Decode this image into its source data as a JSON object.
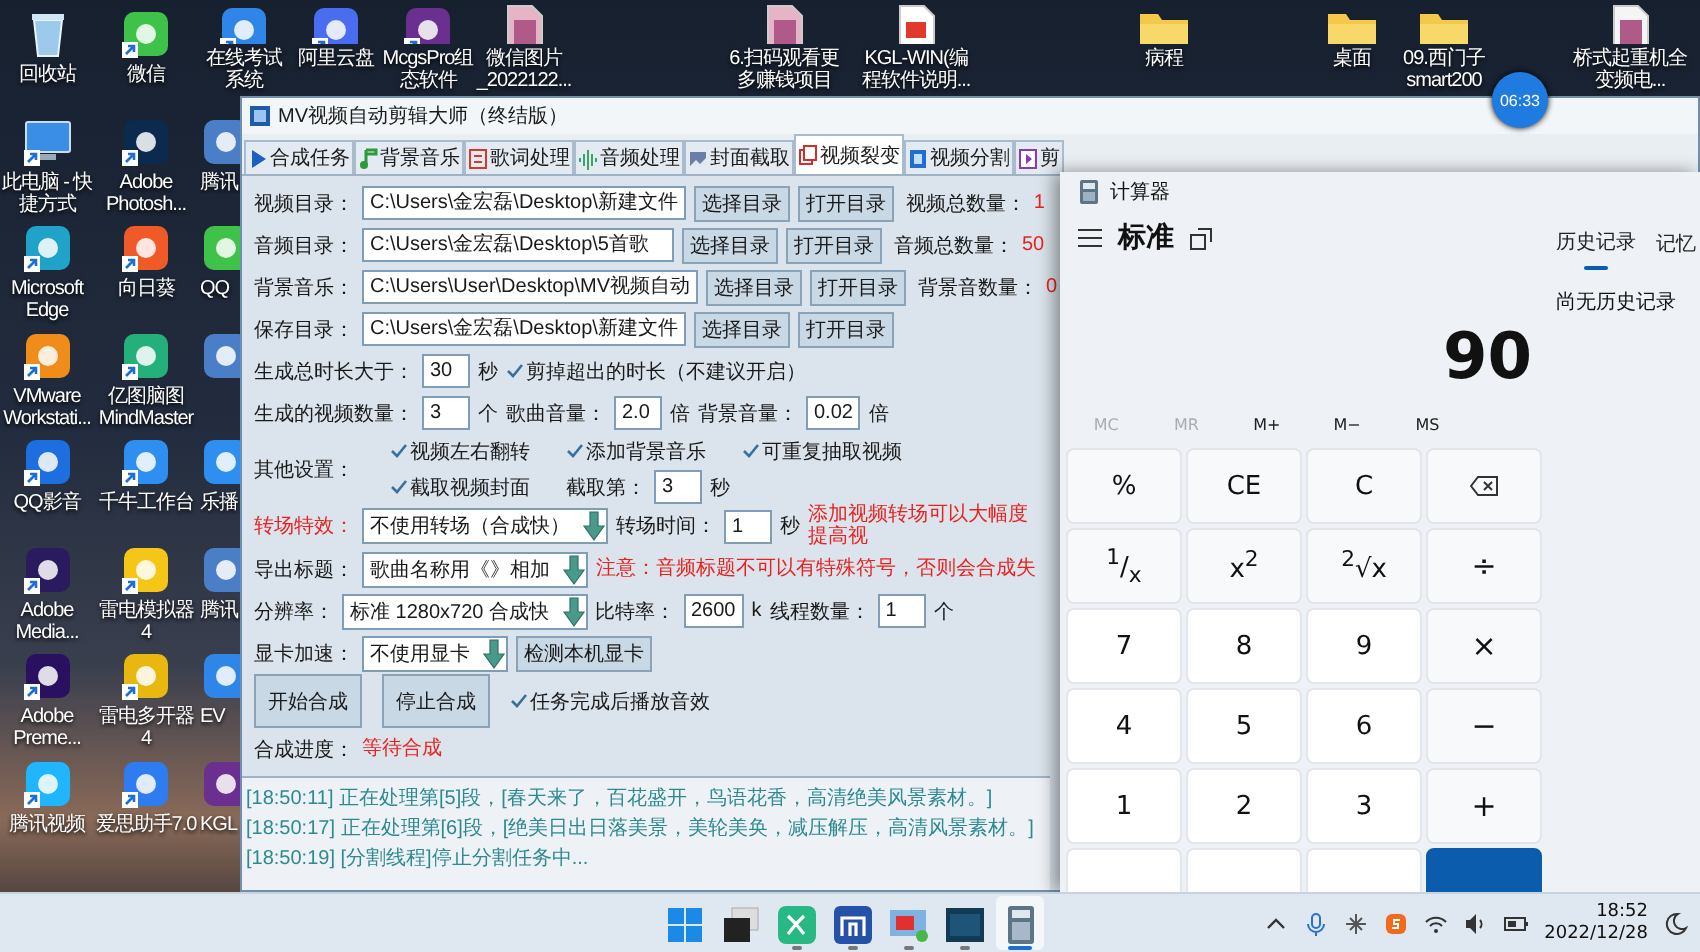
{
  "desktop": {
    "left_icons": [
      {
        "label": "回收站",
        "kind": "recycle",
        "shortcut": false
      },
      {
        "label": "此电脑 - 快捷方式",
        "kind": "monitor",
        "shortcut": true
      },
      {
        "label": "Microsoft Edge",
        "kind": "edge",
        "shortcut": true
      },
      {
        "label": "VMware Workstati...",
        "kind": "vmware",
        "shortcut": true
      },
      {
        "label": "QQ影音",
        "kind": "player",
        "shortcut": true
      },
      {
        "label": "Adobe Media...",
        "kind": "media-encoder",
        "shortcut": true
      },
      {
        "label": "Adobe Preme...",
        "kind": "premiere",
        "shortcut": true
      },
      {
        "label": "腾讯视频",
        "kind": "video",
        "shortcut": true
      },
      {
        "label": "微信",
        "kind": "chat",
        "shortcut": true
      },
      {
        "label": "Adobe Photosh...",
        "kind": "photoshop",
        "shortcut": true
      },
      {
        "label": "向日葵",
        "kind": "remote",
        "shortcut": true
      },
      {
        "label": "亿图脑图 MindMaster",
        "kind": "mindmap",
        "shortcut": true
      },
      {
        "label": "千牛工作台",
        "kind": "workbench",
        "shortcut": true
      },
      {
        "label": "雷电模拟器4",
        "kind": "emulator",
        "shortcut": true
      },
      {
        "label": "雷电多开器4",
        "kind": "multi",
        "shortcut": true
      },
      {
        "label": "爱思助手7.0",
        "kind": "assistant",
        "shortcut": true
      }
    ],
    "partial_icons": [
      {
        "label": "腾讯",
        "kind": "app"
      },
      {
        "label": "QQ",
        "kind": "chat"
      },
      {
        "kind": "app"
      },
      {
        "label": "乐播",
        "kind": "workbench"
      },
      {
        "label": "腾讯",
        "kind": "app"
      },
      {
        "label": "EV",
        "kind": "exam"
      },
      {
        "label": "KGL",
        "kind": "mcgs"
      }
    ],
    "top_icons": [
      {
        "label": "在线考试系统",
        "kind": "exam",
        "shortcut": true
      },
      {
        "label": "阿里云盘",
        "kind": "cloud",
        "shortcut": true
      },
      {
        "label": "McgsPro组态软件",
        "kind": "mcgs",
        "shortcut": true
      },
      {
        "label": "微信图片_2022122...",
        "kind": "image",
        "shortcut": false
      },
      {
        "label": "6.扫码观看更多赚钱项目",
        "kind": "image",
        "shortcut": false
      },
      {
        "label": "KGL-WIN(编程软件说明...",
        "kind": "pdf",
        "shortcut": false
      },
      {
        "label": "病程",
        "kind": "folder",
        "shortcut": false
      },
      {
        "label": "桌面",
        "kind": "folder",
        "shortcut": false
      },
      {
        "label": "09.西门子smart200",
        "kind": "folder",
        "shortcut": false
      },
      {
        "label": "桥式起重机全变频电...",
        "kind": "document",
        "shortcut": false
      }
    ],
    "timer": "06:33"
  },
  "app": {
    "title": "MV视频自动剪辑大师（终结版）",
    "tabs": [
      {
        "label": "合成任务",
        "kind": "play",
        "selected": false
      },
      {
        "label": "背景音乐",
        "kind": "music",
        "selected": false
      },
      {
        "label": "歌词处理",
        "kind": "lyrics",
        "selected": false
      },
      {
        "label": "音频处理",
        "kind": "audio",
        "selected": false
      },
      {
        "label": "封面截取",
        "kind": "image",
        "selected": false
      },
      {
        "label": "视频裂变",
        "kind": "copy",
        "selected": true
      },
      {
        "label": "视频分割",
        "kind": "film",
        "selected": false
      },
      {
        "label": "剪",
        "kind": "clip",
        "selected": false
      }
    ],
    "rows": [
      {
        "items": [
          {
            "kind": "label",
            "text": "视频目录："
          },
          {
            "kind": "path",
            "value": "C:\\Users\\金宏磊\\Desktop\\新建文件"
          },
          {
            "kind": "button",
            "text": "选择目录"
          },
          {
            "kind": "button",
            "text": "打开目录"
          },
          {
            "kind": "stat",
            "text": "视频总数量："
          },
          {
            "kind": "value",
            "text": "1"
          },
          {
            "kind": "cursor"
          }
        ]
      },
      {
        "items": [
          {
            "kind": "label",
            "text": "音频目录："
          },
          {
            "kind": "path",
            "value": "C:\\Users\\金宏磊\\Desktop\\5首歌"
          },
          {
            "kind": "button",
            "text": "选择目录"
          },
          {
            "kind": "button",
            "text": "打开目录"
          },
          {
            "kind": "stat",
            "text": "音频总数量："
          },
          {
            "kind": "value",
            "text": "50"
          }
        ]
      },
      {
        "items": [
          {
            "kind": "label",
            "text": "背景音乐："
          },
          {
            "kind": "path",
            "value": "C:\\Users\\User\\Desktop\\MV视频自动"
          },
          {
            "kind": "button",
            "text": "选择目录"
          },
          {
            "kind": "button",
            "text": "打开目录"
          },
          {
            "kind": "stat",
            "text": "背景音数量："
          },
          {
            "kind": "value",
            "text": "0"
          }
        ]
      },
      {
        "items": [
          {
            "kind": "label",
            "text": "保存目录："
          },
          {
            "kind": "path",
            "value": "C:\\Users\\金宏磊\\Desktop\\新建文件"
          },
          {
            "kind": "button",
            "text": "选择目录"
          },
          {
            "kind": "button",
            "text": "打开目录"
          }
        ]
      },
      {
        "items": [
          {
            "kind": "label",
            "text": "生成总时长大于："
          },
          {
            "kind": "number",
            "value": "30"
          },
          {
            "kind": "unit",
            "text": "秒"
          },
          {
            "kind": "check",
            "text": "剪掉超出的时长（不建议开启）",
            "checked": true
          }
        ]
      },
      {
        "items": [
          {
            "kind": "label",
            "text": "生成的视频数量："
          },
          {
            "kind": "number",
            "value": "3"
          },
          {
            "kind": "unit",
            "text": "个"
          },
          {
            "kind": "label",
            "text": "歌曲音量："
          },
          {
            "kind": "number",
            "value": "2.0"
          },
          {
            "kind": "unit",
            "text": "倍"
          },
          {
            "kind": "label",
            "text": "背景音量："
          },
          {
            "kind": "number",
            "value": "0.02"
          },
          {
            "kind": "unit",
            "text": "倍"
          }
        ]
      },
      {
        "items": [
          {
            "kind": "label",
            "text": "其他设置："
          },
          {
            "kind": "grid",
            "cells": [
              [
                {
                  "kind": "check",
                  "text": "视频左右翻转",
                  "checked": true
                }
              ],
              [
                {
                  "kind": "check",
                  "text": "添加背景音乐",
                  "checked": true
                }
              ],
              [
                {
                  "kind": "check",
                  "text": "可重复抽取视频",
                  "checked": true
                }
              ],
              [
                {
                  "kind": "check",
                  "text": "截取视频封面",
                  "checked": true
                }
              ],
              [
                {
                  "kind": "label",
                  "text": "截取第："
                },
                {
                  "kind": "number",
                  "value": "3"
                },
                {
                  "kind": "unit",
                  "text": "秒"
                }
              ]
            ]
          }
        ]
      },
      {
        "items": [
          {
            "kind": "label",
            "text": "转场特效：",
            "alert": true
          },
          {
            "kind": "select",
            "value": "不使用转场（合成快）"
          },
          {
            "kind": "label",
            "text": "转场时间："
          },
          {
            "kind": "number",
            "value": "1"
          },
          {
            "kind": "unit",
            "text": "秒"
          },
          {
            "kind": "note",
            "text": "添加视频转场可以大幅度提高视"
          }
        ]
      },
      {
        "items": [
          {
            "kind": "label",
            "text": "导出标题："
          },
          {
            "kind": "select",
            "value": "歌曲名称用《》相加"
          },
          {
            "kind": "note",
            "text": "注意：音频标题不可以有特殊符号，否则会合成失"
          }
        ]
      },
      {
        "items": [
          {
            "kind": "label",
            "text": "分辨率："
          },
          {
            "kind": "select",
            "value": "标准 1280x720  合成快"
          },
          {
            "kind": "label",
            "text": "比特率："
          },
          {
            "kind": "number",
            "value": "2600"
          },
          {
            "kind": "unit",
            "text": "k"
          },
          {
            "kind": "label",
            "text": "线程数量："
          },
          {
            "kind": "number",
            "value": "1"
          },
          {
            "kind": "unit",
            "text": "个"
          }
        ]
      },
      {
        "items": [
          {
            "kind": "label",
            "text": "显卡加速："
          },
          {
            "kind": "select",
            "value": "不使用显卡"
          },
          {
            "kind": "button",
            "text": "检测本机显卡"
          }
        ]
      },
      {
        "items": [
          {
            "kind": "big-button",
            "text": "开始合成"
          },
          {
            "kind": "big-button",
            "text": "停止合成"
          },
          {
            "kind": "check",
            "text": "任务完成后播放音效",
            "checked": true
          }
        ]
      },
      {
        "items": [
          {
            "kind": "label",
            "text": "合成进度："
          },
          {
            "kind": "note",
            "text": "等待合成"
          }
        ]
      }
    ],
    "log": [
      "[18:50:11] 正在处理第[5]段，[春天来了，百花盛开，鸟语花香，高清绝美风景素材。]",
      "[18:50:17] 正在处理第[6]段，[绝美日出日落美景，美轮美奂，减压解压，高清风景素材。]",
      "[18:50:19] [分割线程]停止分割任务中..."
    ]
  },
  "calculator": {
    "title": "计算器",
    "mode": "标准",
    "display": "90",
    "history_tabs": [
      {
        "label": "历史记录",
        "selected": true
      },
      {
        "label": "记忆",
        "selected": false
      }
    ],
    "history_empty": "尚无历史记录",
    "memory": [
      {
        "label": "MC",
        "disabled": true
      },
      {
        "label": "MR",
        "disabled": true
      },
      {
        "label": "M+",
        "disabled": false
      },
      {
        "label": "M−",
        "disabled": false
      },
      {
        "label": "MS",
        "disabled": false
      }
    ],
    "keys": [
      {
        "label": "%",
        "kind": "function"
      },
      {
        "label": "CE",
        "kind": "function"
      },
      {
        "label": "C",
        "kind": "function"
      },
      {
        "kind": "backspace"
      },
      {
        "label": "$^{1}$/$_{x}$",
        "kind": "function"
      },
      {
        "label": "x$^{2}$",
        "kind": "function"
      },
      {
        "label": "$^{2}$√x",
        "kind": "function"
      },
      {
        "label": "÷",
        "kind": "operator"
      },
      {
        "label": "7",
        "kind": "digit"
      },
      {
        "label": "8",
        "kind": "digit"
      },
      {
        "label": "9",
        "kind": "digit"
      },
      {
        "label": "×",
        "kind": "operator"
      },
      {
        "label": "4",
        "kind": "digit"
      },
      {
        "label": "5",
        "kind": "digit"
      },
      {
        "label": "6",
        "kind": "digit"
      },
      {
        "label": "−",
        "kind": "operator"
      },
      {
        "label": "1",
        "kind": "digit"
      },
      {
        "label": "2",
        "kind": "digit"
      },
      {
        "label": "3",
        "kind": "digit"
      },
      {
        "label": "+",
        "kind": "operator"
      }
    ]
  },
  "taskbar": {
    "apps": [
      {
        "kind": "start",
        "running": false,
        "active": false
      },
      {
        "kind": "desktops",
        "running": false,
        "active": false
      },
      {
        "kind": "mindmap",
        "running": true,
        "active": false
      },
      {
        "kind": "browser",
        "running": true,
        "active": false
      },
      {
        "kind": "recorder",
        "running": true,
        "active": false
      },
      {
        "kind": "terminal",
        "running": true,
        "active": false
      },
      {
        "kind": "calculator",
        "running": true,
        "active": true
      }
    ],
    "time": "18:52",
    "date": "2022/12/28"
  }
}
